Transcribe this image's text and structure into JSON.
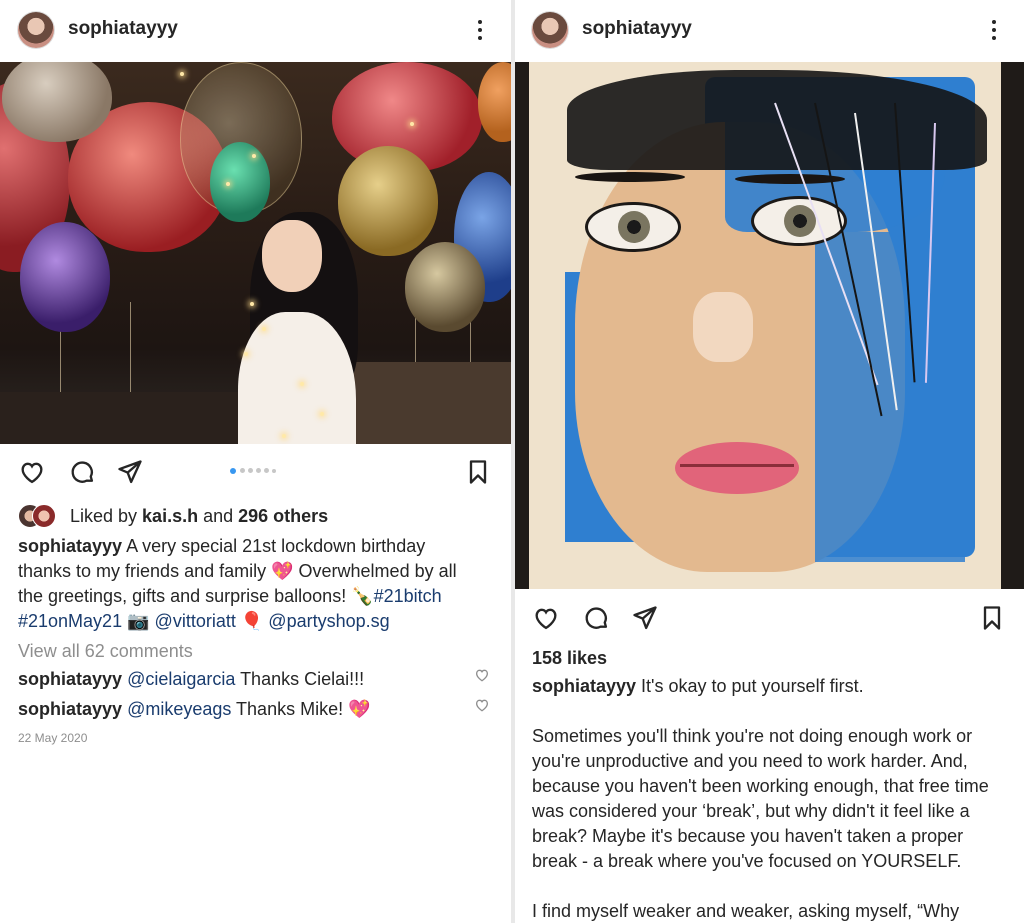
{
  "left_post": {
    "username": "sophiatayyy",
    "carousel": {
      "count": 6,
      "active": 0
    },
    "likes": {
      "prefix": "Liked by ",
      "user": "kai.s.h",
      "middle": " and ",
      "others": "296 others"
    },
    "caption": {
      "username": "sophiatayyy",
      "line1": "A very special 21st lockdown birthday",
      "line2a": "thanks to my friends and family ",
      "line2_emoji": "💖",
      "line2b": " Overwhelmed by all",
      "line3a": "the greetings, gifts and surprise balloons! ",
      "line3_emoji": "🍾",
      "line3_tag": "#21bitch",
      "line4_tag": "#21onMay21",
      "line4_emoji1": "📷",
      "line4_mention1": "@vittoriatt",
      "line4_emoji2": "🎈",
      "line4_mention2": "@partyshop.sg"
    },
    "view_comments": "View all 62 comments",
    "comments": [
      {
        "user": "sophiatayyy",
        "mention": "@cielaigarcia",
        "text": " Thanks Cielai!!!"
      },
      {
        "user": "sophiatayyy",
        "mention": "@mikeyeags",
        "text": " Thanks Mike! ",
        "emoji": "💖"
      }
    ],
    "date": "22 May 2020"
  },
  "right_post": {
    "username": "sophiatayyy",
    "likes": "158 likes",
    "caption_user": "sophiatayyy",
    "caption_first": " It's okay to put yourself first.",
    "para1": [
      "Sometimes you'll think you're not doing enough work or",
      "you're unproductive and you need to work harder. And,",
      "because you haven't been working enough, that free time",
      "was considered your ‘break’, but why didn't it feel like a",
      "break? Maybe it's because you haven't taken a proper",
      "break - a break where you've focused on YOURSELF."
    ],
    "para2": "I find myself weaker and weaker, asking myself, “Why"
  },
  "colors": {
    "link": "#1a3c6e",
    "muted": "#8e8e8e",
    "text": "#262626",
    "carousel_active": "#3897f0"
  },
  "icons": [
    "heart-icon",
    "comment-icon",
    "share-icon",
    "bookmark-icon",
    "more-icon"
  ]
}
